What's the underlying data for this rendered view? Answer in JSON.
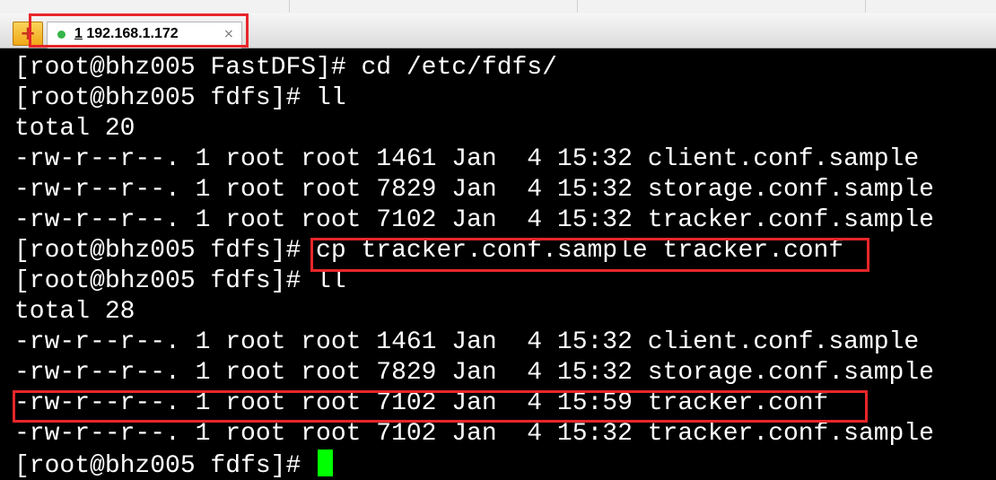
{
  "tab": {
    "session_number": "1",
    "host": "192.168.1.172",
    "close_symbol": "×",
    "status_color": "#35b54a"
  },
  "terminal": {
    "lines": [
      "[root@bhz005 FastDFS]# cd /etc/fdfs/",
      "[root@bhz005 fdfs]# ll",
      "total 20",
      "-rw-r--r--. 1 root root 1461 Jan  4 15:32 client.conf.sample",
      "-rw-r--r--. 1 root root 7829 Jan  4 15:32 storage.conf.sample",
      "-rw-r--r--. 1 root root 7102 Jan  4 15:32 tracker.conf.sample",
      "[root@bhz005 fdfs]# cp tracker.conf.sample tracker.conf",
      "[root@bhz005 fdfs]# ll",
      "total 28",
      "-rw-r--r--. 1 root root 1461 Jan  4 15:32 client.conf.sample",
      "-rw-r--r--. 1 root root 7829 Jan  4 15:32 storage.conf.sample",
      "-rw-r--r--. 1 root root 7102 Jan  4 15:59 tracker.conf",
      "-rw-r--r--. 1 root root 7102 Jan  4 15:32 tracker.conf.sample"
    ],
    "prompt": "[root@bhz005 fdfs]# ",
    "text_color": "#ffffff",
    "background_color": "#000000",
    "cursor_color": "#00ff00",
    "highlight_color": "#e8262a"
  }
}
